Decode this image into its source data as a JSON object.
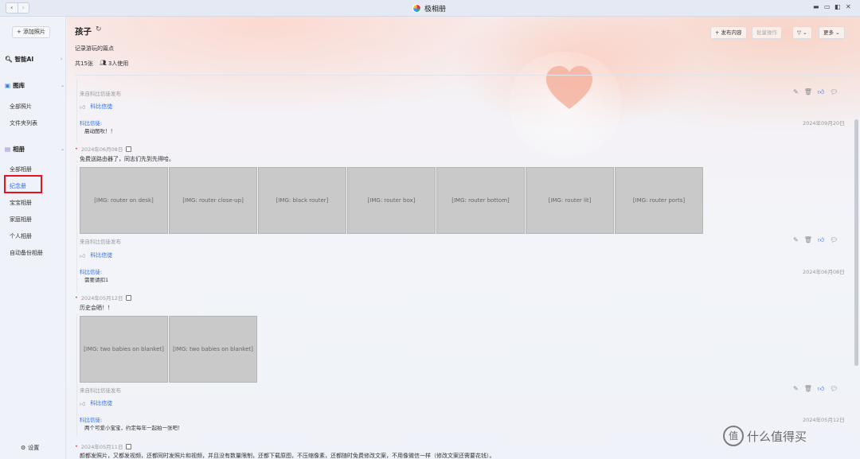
{
  "window": {
    "title": "极相册",
    "back": "‹",
    "forward": "›"
  },
  "sidebar": {
    "add_photo": "+ 添加照片",
    "ai": "智能AI",
    "gallery": "图库",
    "gallery_items": [
      "全部照片",
      "文件夹列表"
    ],
    "albums": "相册",
    "album_items": [
      "全部相册",
      "纪念册",
      "宝宝相册",
      "家庭相册",
      "个人相册",
      "自动备份相册"
    ],
    "active_index": 1,
    "settings": "设置"
  },
  "header": {
    "title": "孩子",
    "subtitle": "记录游玩的篇点",
    "photo_count": "共15张",
    "users": "3人使用",
    "toolbar": {
      "publish": "+ 发布内容",
      "batch": "批量操作",
      "filter": "▽ ⌄",
      "more": "更多 ⌄"
    }
  },
  "posts": [
    {
      "meta": "来自科比信徒发布",
      "likers": "科比信徒",
      "comment_user": "科比信徒:",
      "comment": "晨动图吹！！",
      "comment_date": "2024年09月20日"
    },
    {
      "date": "2024年06月08日",
      "text": "免费送路由器了，同志们先到先得哈。",
      "photo_count": 7,
      "meta": "来自科比信徒发布",
      "likers": "科比信徒",
      "comment_user": "科比信徒:",
      "comment": "需要请扣1",
      "comment_date": "2024年06月08日"
    },
    {
      "date": "2024年05月12日",
      "text": "历史会晒！！",
      "photo_count": 2,
      "meta": "来自科比信徒发布",
      "likers": "科比信徒",
      "comment_user": "科比信徒:",
      "comment": "两个可爱小宝宝，约定每年一起拍一张吧！",
      "comment_date": "2024年05月12日"
    },
    {
      "date": "2024年05月11日",
      "text": "颜都发照片，又都发视频，还都同时发照片和视频，并且没有数量限制，还都下载原图，不压缩像素，还都随时免费修改文案，不用像微信一样（修改文案还需要花钱）。"
    }
  ],
  "watermark": {
    "text": "什么值得买",
    "symbol": "值"
  }
}
